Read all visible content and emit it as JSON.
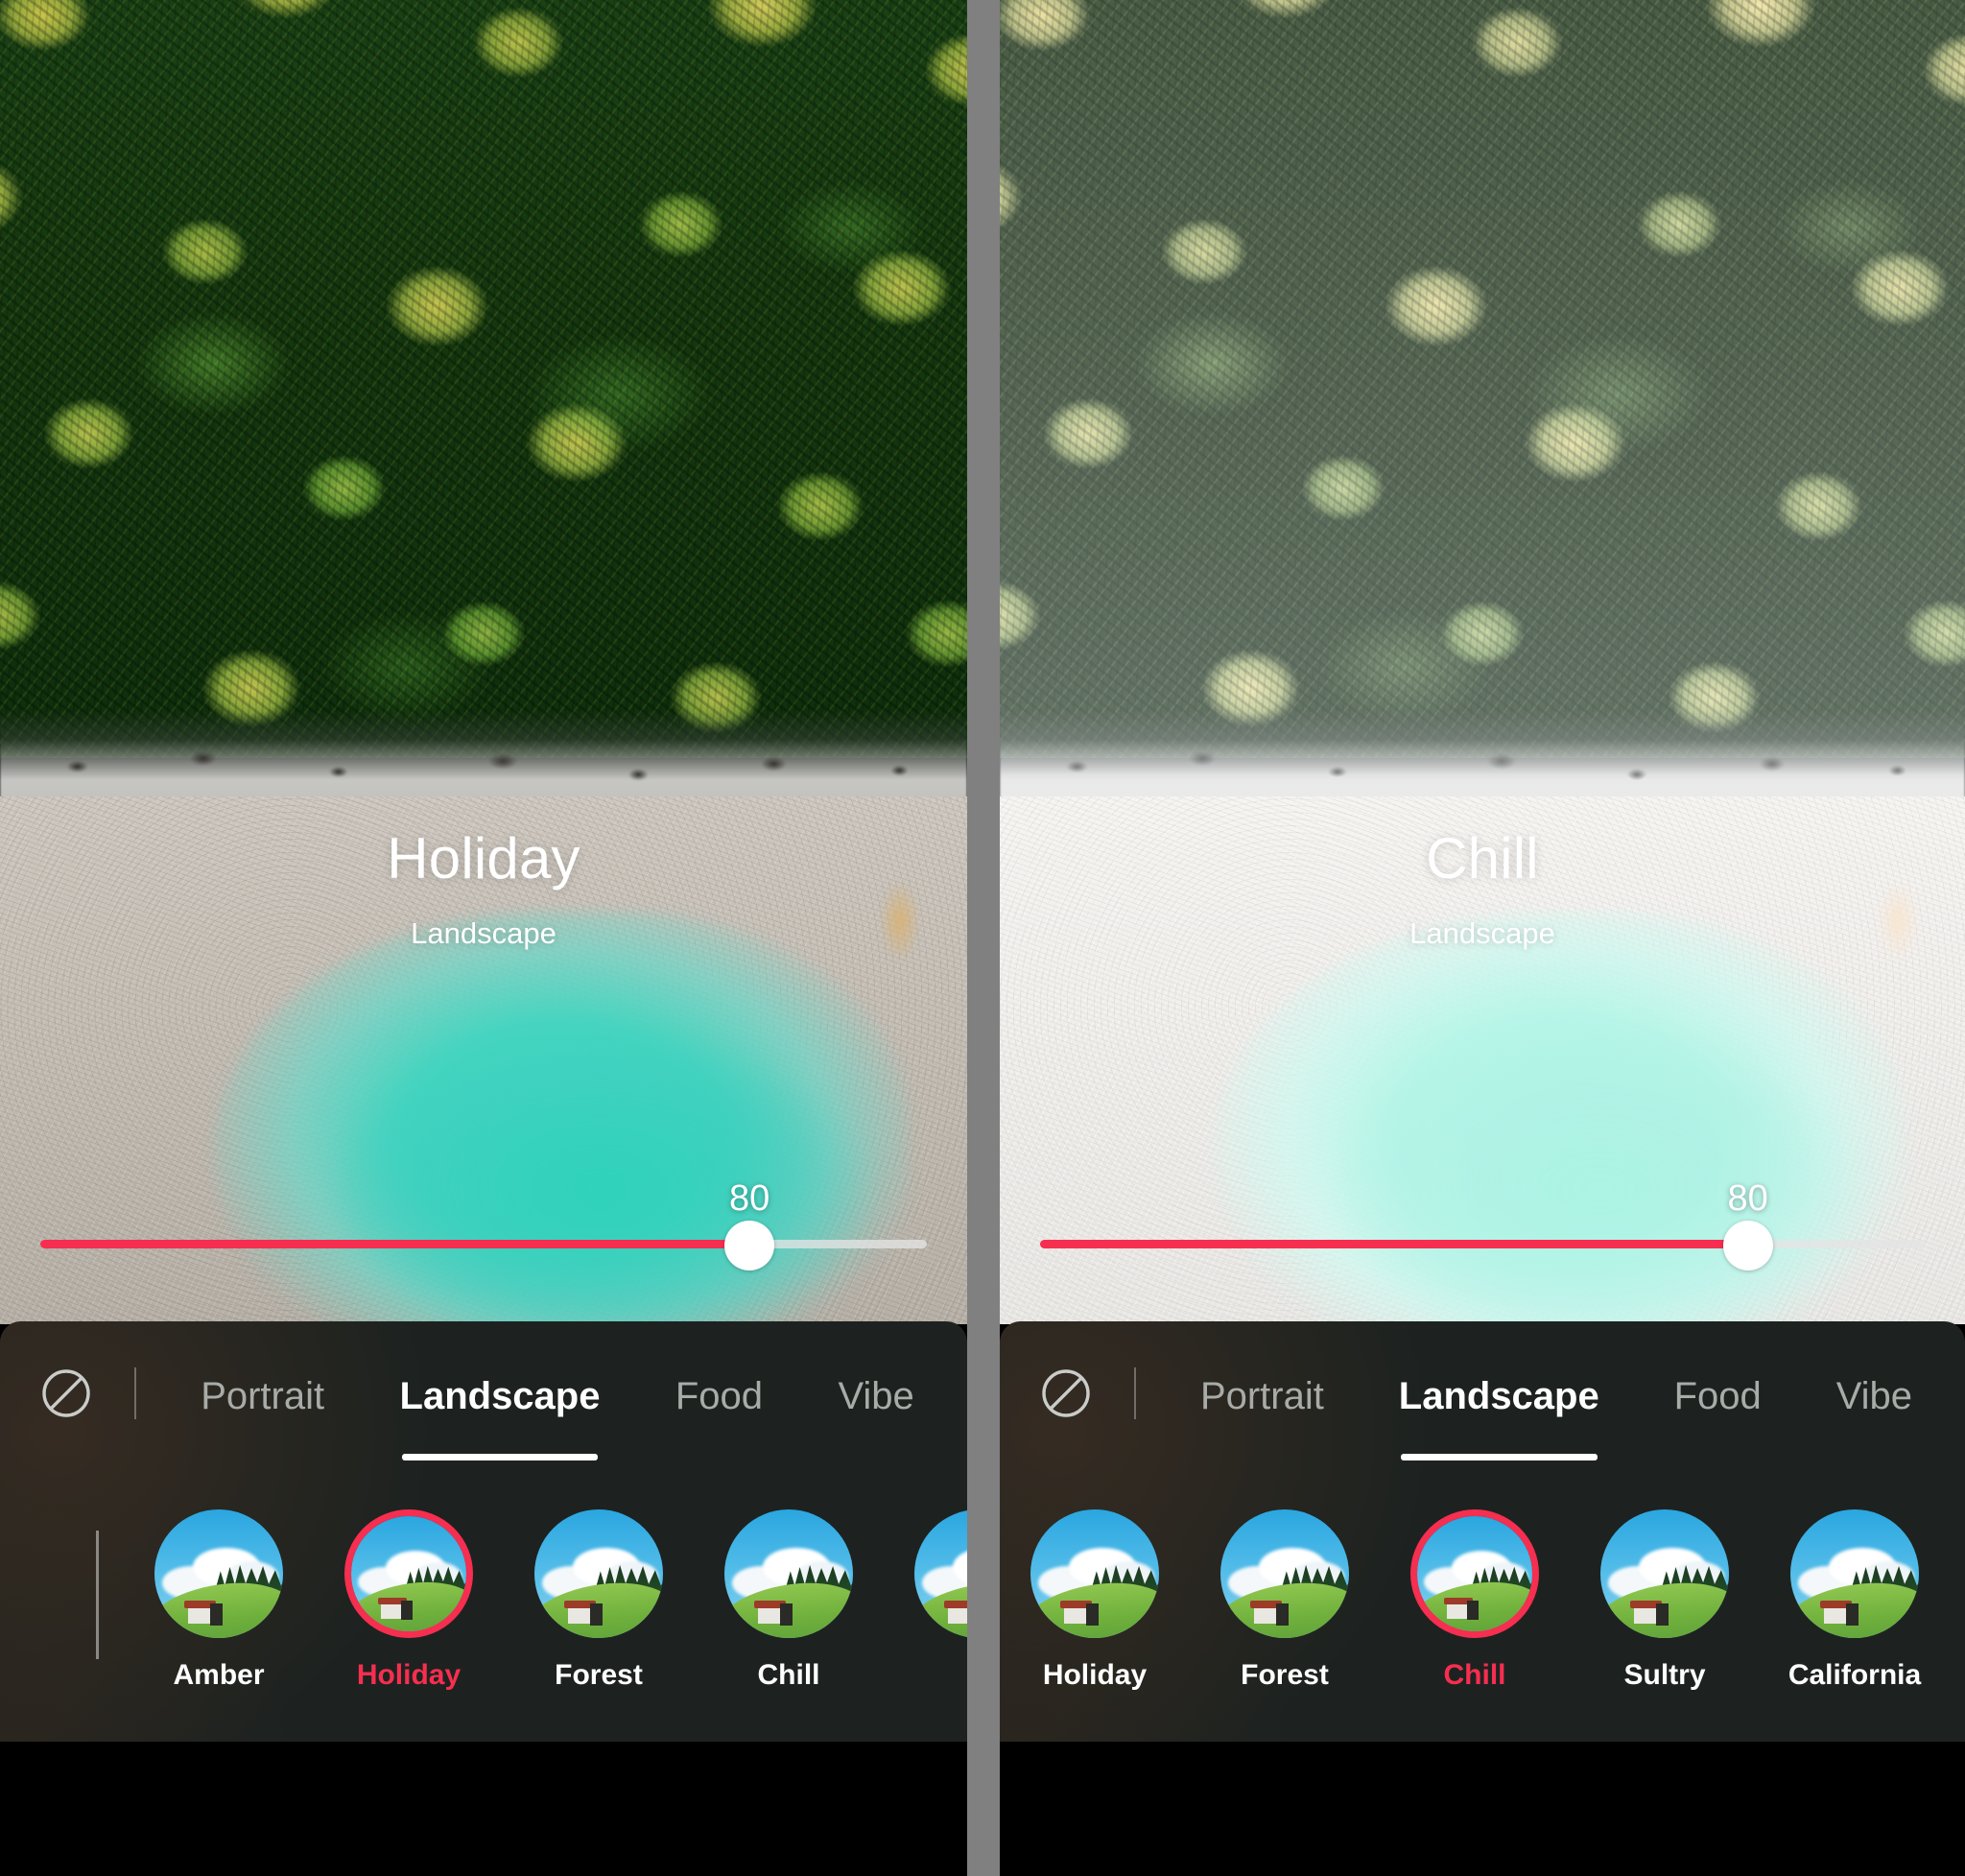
{
  "app": {
    "name": "Photo Filter Editor",
    "divider_color": "#808080",
    "accent_color": "#F62E50",
    "panel_bg": "#1d2220"
  },
  "panels": [
    {
      "id": "left",
      "overlay": {
        "title": "Holiday",
        "subtitle": "Landscape"
      },
      "slider": {
        "value": "80",
        "value_number": 80,
        "min": 0,
        "max": 100,
        "fill_color": "#F62E50"
      },
      "toolbar": {
        "no_filter_icon": "circle-slash-icon",
        "tabs": [
          {
            "label": "Portrait",
            "active": false
          },
          {
            "label": "Landscape",
            "active": true
          },
          {
            "label": "Food",
            "active": false
          },
          {
            "label": "Vibe",
            "active": false
          }
        ]
      },
      "filters": [
        {
          "label": "Amber",
          "selected": false
        },
        {
          "label": "Holiday",
          "selected": true
        },
        {
          "label": "Forest",
          "selected": false
        },
        {
          "label": "Chill",
          "selected": false
        },
        {
          "label": "",
          "selected": false
        }
      ]
    },
    {
      "id": "right",
      "overlay": {
        "title": "Chill",
        "subtitle": "Landscape"
      },
      "slider": {
        "value": "80",
        "value_number": 80,
        "min": 0,
        "max": 100,
        "fill_color": "#F62E50"
      },
      "toolbar": {
        "no_filter_icon": "circle-slash-icon",
        "tabs": [
          {
            "label": "Portrait",
            "active": false
          },
          {
            "label": "Landscape",
            "active": true
          },
          {
            "label": "Food",
            "active": false
          },
          {
            "label": "Vibe",
            "active": false
          }
        ]
      },
      "filters": [
        {
          "label": "Holiday",
          "selected": false
        },
        {
          "label": "Forest",
          "selected": false
        },
        {
          "label": "Chill",
          "selected": true
        },
        {
          "label": "Sultry",
          "selected": false
        },
        {
          "label": "California",
          "selected": false
        }
      ]
    }
  ]
}
